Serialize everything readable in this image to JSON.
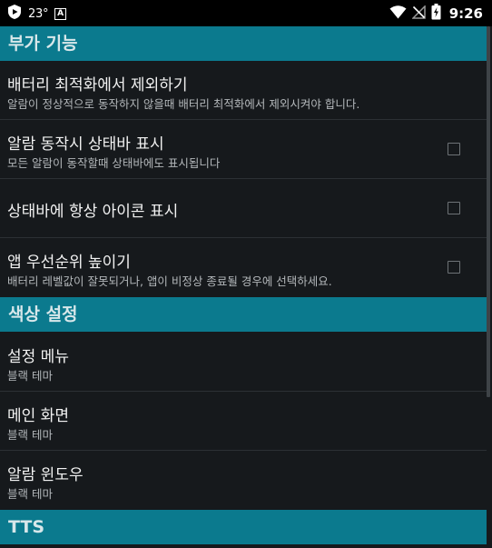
{
  "status_bar": {
    "temperature": "23°",
    "notification_letter": "A",
    "time": "9:26",
    "icons": [
      "shield-play-icon",
      "a-notification-icon",
      "wifi-icon",
      "no-signal-icon",
      "battery-charging-icon"
    ]
  },
  "colors": {
    "section_header_bg": "#0b7a8e",
    "background": "#16191c",
    "status_bar_bg": "#000000"
  },
  "sections": {
    "extra": {
      "title": "부가 기능"
    },
    "color": {
      "title": "색상 설정"
    },
    "tts": {
      "title": "TTS"
    }
  },
  "prefs": {
    "battery": {
      "title": "배터리 최적화에서 제외하기",
      "summary": "알람이 정상적으로 동작하지 않을때 배터리 최적화에서 제외시켜야 합니다."
    },
    "alarm_status": {
      "title": "알람 동작시 상태바 표시",
      "summary": "모든 알람이 동작할때 상태바에도 표시됩니다",
      "checked": false
    },
    "always_icon": {
      "title": "상태바에 항상 아이콘 표시",
      "checked": false
    },
    "priority": {
      "title": "앱 우선순위 높이기",
      "summary": "배터리 레벨값이 잘못되거나, 앱이 비정상 종료될 경우에 선택하세요.",
      "checked": false
    },
    "settings_menu": {
      "title": "설정 메뉴",
      "summary": "블랙 테마"
    },
    "main_screen": {
      "title": "메인 화면",
      "summary": "블랙 테마"
    },
    "alarm_window": {
      "title": "알람 윈도우",
      "summary": "블랙 테마"
    }
  }
}
